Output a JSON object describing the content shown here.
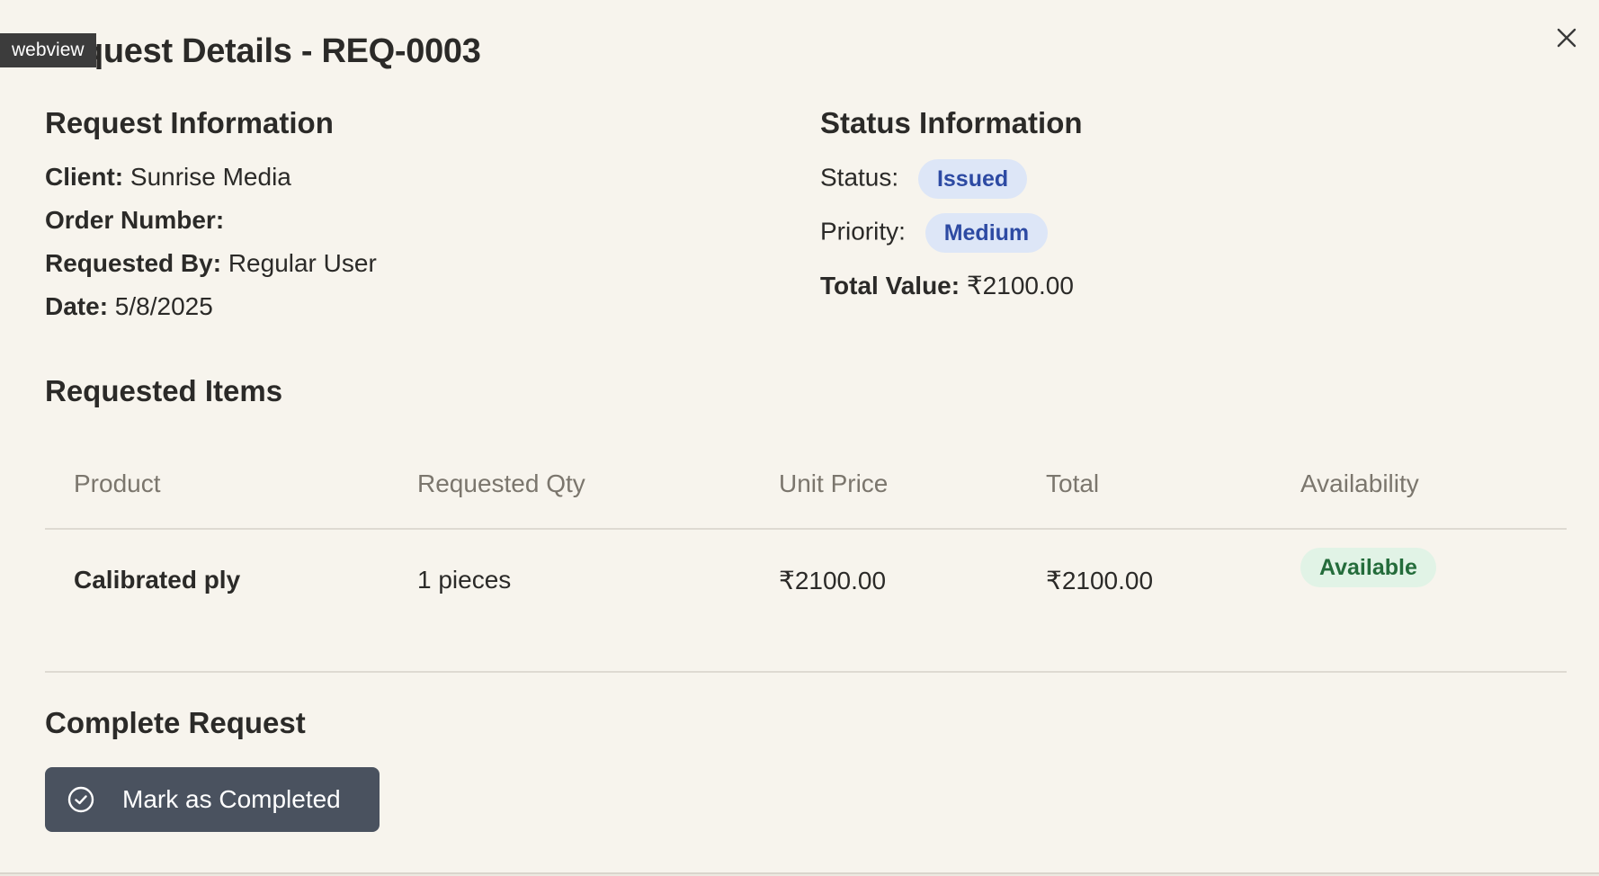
{
  "overlay": {
    "tag_label": "webview"
  },
  "modal": {
    "title": "Request Details - REQ-0003",
    "close_icon": "close-icon"
  },
  "request_info": {
    "heading": "Request Information",
    "client_label": "Client:",
    "client_value": "Sunrise Media",
    "order_label": "Order Number:",
    "order_value": "",
    "requested_by_label": "Requested By:",
    "requested_by_value": "Regular User",
    "date_label": "Date:",
    "date_value": "5/8/2025"
  },
  "status_info": {
    "heading": "Status Information",
    "status_label": "Status:",
    "status_value": "Issued",
    "priority_label": "Priority:",
    "priority_value": "Medium",
    "total_label": "Total Value:",
    "total_value": "₹2100.00"
  },
  "items": {
    "heading": "Requested Items",
    "columns": [
      "Product",
      "Requested Qty",
      "Unit Price",
      "Total",
      "Availability"
    ],
    "rows": [
      {
        "product": "Calibrated ply",
        "qty": "1 pieces",
        "unit_price": "₹2100.00",
        "total": "₹2100.00",
        "availability": "Available"
      }
    ]
  },
  "complete": {
    "heading": "Complete Request",
    "button_label": "Mark as Completed",
    "button_icon": "check-circle-icon"
  },
  "colors": {
    "background": "#f7f4ed",
    "primary_button": "#4a525f",
    "badge_blue_bg": "#dde6f7",
    "badge_blue_text": "#2d4aa3",
    "badge_green_bg": "#e1f3e6",
    "badge_green_text": "#246c3b"
  }
}
